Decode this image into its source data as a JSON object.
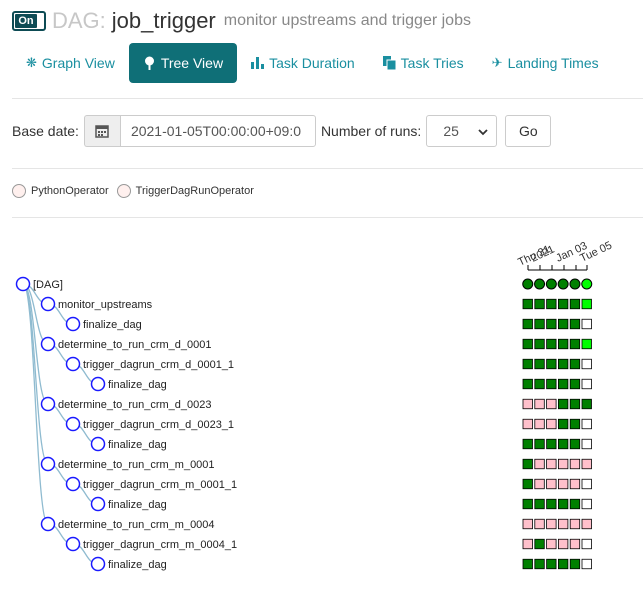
{
  "header": {
    "toggle_label": "On",
    "title_prefix": "DAG:",
    "dag_id": "job_trigger",
    "description": "monitor upstreams and trigger jobs"
  },
  "tabs": [
    {
      "label": "Graph View",
      "icon": "asterisk-icon",
      "active": false
    },
    {
      "label": "Tree View",
      "icon": "tree-icon",
      "active": true
    },
    {
      "label": "Task Duration",
      "icon": "bar-chart-icon",
      "active": false
    },
    {
      "label": "Task Tries",
      "icon": "duplicate-icon",
      "active": false
    },
    {
      "label": "Landing Times",
      "icon": "plane-icon",
      "active": false
    }
  ],
  "form": {
    "base_date_label": "Base date:",
    "base_date_value": "2021-01-05T00:00:00+09:0",
    "num_runs_label": "Number of runs:",
    "num_runs_value": "25",
    "go_label": "Go"
  },
  "legend": [
    {
      "label": "PythonOperator",
      "color": "#fff0ee"
    },
    {
      "label": "TriggerDagRunOperator",
      "color": "#fff0ee"
    }
  ],
  "axis_labels": [
    "Thu 31",
    "2021",
    "Jan 03",
    "Tue 05"
  ],
  "colors": {
    "success": "#008000",
    "running": "#01fe01",
    "upstream_failed": "#ffc0cb",
    "none": "#ffffff",
    "accent": "#0f6f77"
  },
  "tree": [
    {
      "label": "[DAG]",
      "depth": 0,
      "parent": null,
      "states": [
        "success",
        "success",
        "success",
        "success",
        "success",
        "running"
      ]
    },
    {
      "label": "monitor_upstreams",
      "depth": 1,
      "parent": 0,
      "states": [
        "success",
        "success",
        "success",
        "success",
        "success",
        "running"
      ]
    },
    {
      "label": "finalize_dag",
      "depth": 2,
      "parent": 1,
      "states": [
        "success",
        "success",
        "success",
        "success",
        "success",
        "none"
      ]
    },
    {
      "label": "determine_to_run_crm_d_0001",
      "depth": 1,
      "parent": 0,
      "states": [
        "success",
        "success",
        "success",
        "success",
        "success",
        "running"
      ]
    },
    {
      "label": "trigger_dagrun_crm_d_0001_1",
      "depth": 2,
      "parent": 3,
      "states": [
        "success",
        "success",
        "success",
        "success",
        "success",
        "none"
      ]
    },
    {
      "label": "finalize_dag",
      "depth": 3,
      "parent": 4,
      "states": [
        "success",
        "success",
        "success",
        "success",
        "success",
        "none"
      ]
    },
    {
      "label": "determine_to_run_crm_d_0023",
      "depth": 1,
      "parent": 0,
      "states": [
        "upstream_failed",
        "upstream_failed",
        "upstream_failed",
        "success",
        "success",
        "success"
      ]
    },
    {
      "label": "trigger_dagrun_crm_d_0023_1",
      "depth": 2,
      "parent": 6,
      "states": [
        "upstream_failed",
        "upstream_failed",
        "upstream_failed",
        "success",
        "success",
        "none"
      ]
    },
    {
      "label": "finalize_dag",
      "depth": 3,
      "parent": 7,
      "states": [
        "success",
        "success",
        "success",
        "success",
        "success",
        "none"
      ]
    },
    {
      "label": "determine_to_run_crm_m_0001",
      "depth": 1,
      "parent": 0,
      "states": [
        "success",
        "upstream_failed",
        "upstream_failed",
        "upstream_failed",
        "upstream_failed",
        "upstream_failed"
      ]
    },
    {
      "label": "trigger_dagrun_crm_m_0001_1",
      "depth": 2,
      "parent": 9,
      "states": [
        "success",
        "upstream_failed",
        "upstream_failed",
        "upstream_failed",
        "upstream_failed",
        "none"
      ]
    },
    {
      "label": "finalize_dag",
      "depth": 3,
      "parent": 10,
      "states": [
        "success",
        "success",
        "success",
        "success",
        "success",
        "none"
      ]
    },
    {
      "label": "determine_to_run_crm_m_0004",
      "depth": 1,
      "parent": 0,
      "states": [
        "upstream_failed",
        "upstream_failed",
        "upstream_failed",
        "upstream_failed",
        "upstream_failed",
        "upstream_failed"
      ]
    },
    {
      "label": "trigger_dagrun_crm_m_0004_1",
      "depth": 2,
      "parent": 12,
      "states": [
        "upstream_failed",
        "success",
        "upstream_failed",
        "upstream_failed",
        "upstream_failed",
        "none"
      ]
    },
    {
      "label": "finalize_dag",
      "depth": 3,
      "parent": 13,
      "states": [
        "success",
        "success",
        "success",
        "success",
        "success",
        "none"
      ]
    }
  ]
}
